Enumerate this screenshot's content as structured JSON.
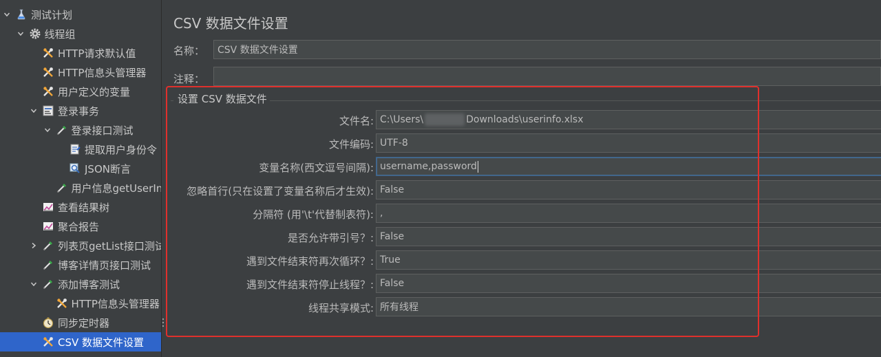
{
  "tree": {
    "items": [
      {
        "label": "测试计划",
        "icon": "flask-icon",
        "arrow": "down",
        "depth": 0
      },
      {
        "label": "线程组",
        "icon": "gear-icon",
        "arrow": "down",
        "depth": 1
      },
      {
        "label": "HTTP请求默认值",
        "icon": "wrench-icon",
        "arrow": "",
        "depth": 2
      },
      {
        "label": "HTTP信息头管理器",
        "icon": "wrench-icon",
        "arrow": "",
        "depth": 2
      },
      {
        "label": "用户定义的变量",
        "icon": "wrench-icon",
        "arrow": "",
        "depth": 2
      },
      {
        "label": "登录事务",
        "icon": "transaction-icon",
        "arrow": "down",
        "depth": 2
      },
      {
        "label": "登录接口测试",
        "icon": "pipette-icon",
        "arrow": "down",
        "depth": 3
      },
      {
        "label": "提取用户身份令",
        "icon": "extractor-icon",
        "arrow": "",
        "depth": 4
      },
      {
        "label": "JSON断言",
        "icon": "magnifier-icon",
        "arrow": "",
        "depth": 4
      },
      {
        "label": "用户信息getUserIn",
        "icon": "pipette-icon",
        "arrow": "",
        "depth": 3
      },
      {
        "label": "查看结果树",
        "icon": "graph-icon",
        "arrow": "",
        "depth": 2
      },
      {
        "label": "聚合报告",
        "icon": "graph-icon",
        "arrow": "",
        "depth": 2
      },
      {
        "label": "列表页getList接口测试",
        "icon": "pipette-icon",
        "arrow": "right",
        "depth": 2
      },
      {
        "label": "博客详情页接口测试",
        "icon": "pipette-icon",
        "arrow": "",
        "depth": 2
      },
      {
        "label": "添加博客测试",
        "icon": "pipette-icon",
        "arrow": "down",
        "depth": 2
      },
      {
        "label": "HTTP信息头管理器",
        "icon": "wrench-icon",
        "arrow": "",
        "depth": 3
      },
      {
        "label": "同步定时器",
        "icon": "timer-icon",
        "arrow": "",
        "depth": 2
      },
      {
        "label": "CSV 数据文件设置",
        "icon": "wrench-icon",
        "arrow": "",
        "depth": 2,
        "selected": true
      }
    ]
  },
  "main": {
    "title": "CSV 数据文件设置",
    "name_label": "名称：",
    "name_value": "CSV 数据文件设置",
    "comment_label": "注释：",
    "comment_value": "",
    "group_title": "设置 CSV 数据文件",
    "rows": [
      {
        "label": "文件名:",
        "value_prefix": "C:\\Users\\",
        "value_suffix": "Downloads\\userinfo.xlsx",
        "redacted": true
      },
      {
        "label": "文件编码:",
        "value": "UTF-8"
      },
      {
        "label": "变量名称(西文逗号间隔):",
        "value": "username,password",
        "focused": true
      },
      {
        "label": "忽略首行(只在设置了变量名称后才生效):",
        "value": "False"
      },
      {
        "label": "分隔符 (用'\\t'代替制表符):",
        "value": ","
      },
      {
        "label": "是否允许带引号？:",
        "value": "False"
      },
      {
        "label": "遇到文件结束符再次循环？:",
        "value": "True"
      },
      {
        "label": "遇到文件结束符停止线程？:",
        "value": "False"
      },
      {
        "label": "线程共享模式:",
        "value": "所有线程"
      }
    ]
  },
  "colors": {
    "highlight": "#e0302c",
    "selection": "#2f65ca",
    "background": "#3c3f41"
  }
}
